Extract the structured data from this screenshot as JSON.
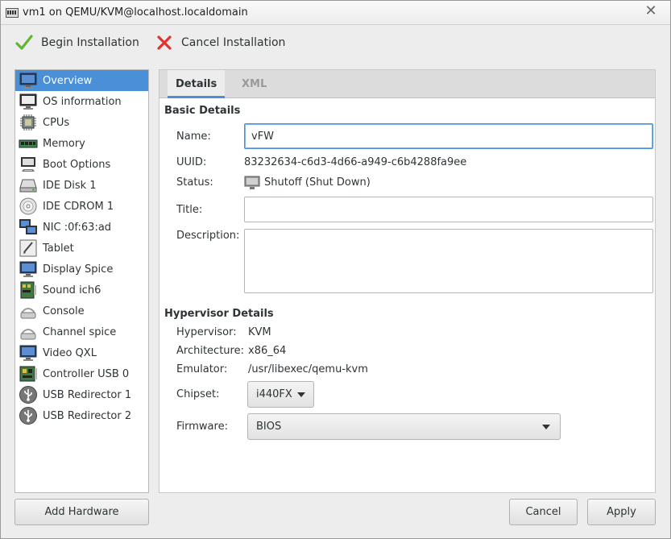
{
  "window": {
    "title": "vm1 on QEMU/KVM@localhost.localdomain",
    "close_glyph": "✕"
  },
  "toolbar": {
    "begin_label": "Begin Installation",
    "cancel_label": "Cancel Installation"
  },
  "sidebar": {
    "items": [
      {
        "label": "Overview",
        "icon": "monitor-icon"
      },
      {
        "label": "OS information",
        "icon": "os-info-icon"
      },
      {
        "label": "CPUs",
        "icon": "cpu-icon"
      },
      {
        "label": "Memory",
        "icon": "memory-icon"
      },
      {
        "label": "Boot Options",
        "icon": "boot-options-icon"
      },
      {
        "label": "IDE Disk 1",
        "icon": "disk-icon"
      },
      {
        "label": "IDE CDROM 1",
        "icon": "cdrom-icon"
      },
      {
        "label": "NIC :0f:63:ad",
        "icon": "network-icon"
      },
      {
        "label": "Tablet",
        "icon": "tablet-icon"
      },
      {
        "label": "Display Spice",
        "icon": "display-icon"
      },
      {
        "label": "Sound ich6",
        "icon": "sound-icon"
      },
      {
        "label": "Console",
        "icon": "console-icon"
      },
      {
        "label": "Channel spice",
        "icon": "channel-icon"
      },
      {
        "label": "Video QXL",
        "icon": "video-icon"
      },
      {
        "label": "Controller USB 0",
        "icon": "controller-icon"
      },
      {
        "label": "USB Redirector 1",
        "icon": "usb-icon"
      },
      {
        "label": "USB Redirector 2",
        "icon": "usb-icon"
      }
    ],
    "add_hardware_label": "Add Hardware"
  },
  "tabs": {
    "details": "Details",
    "xml": "XML"
  },
  "basic": {
    "section_title": "Basic Details",
    "name_label": "Name:",
    "name_value": "vFW",
    "uuid_label": "UUID:",
    "uuid_value": "83232634-c6d3-4d66-a949-c6b4288fa9ee",
    "status_label": "Status:",
    "status_value": "Shutoff (Shut Down)",
    "title_label": "Title:",
    "title_value": "",
    "description_label": "Description:",
    "description_value": ""
  },
  "hypervisor": {
    "section_title": "Hypervisor Details",
    "hypervisor_label": "Hypervisor:",
    "hypervisor_value": "KVM",
    "architecture_label": "Architecture:",
    "architecture_value": "x86_64",
    "emulator_label": "Emulator:",
    "emulator_value": "/usr/libexec/qemu-kvm",
    "chipset_label": "Chipset:",
    "chipset_value": "i440FX",
    "firmware_label": "Firmware:",
    "firmware_value": "BIOS"
  },
  "footer": {
    "cancel_label": "Cancel",
    "apply_label": "Apply"
  },
  "colors": {
    "accent": "#4a90d9",
    "begin_check": "#5cb82e",
    "cancel_x": "#e0322f"
  }
}
